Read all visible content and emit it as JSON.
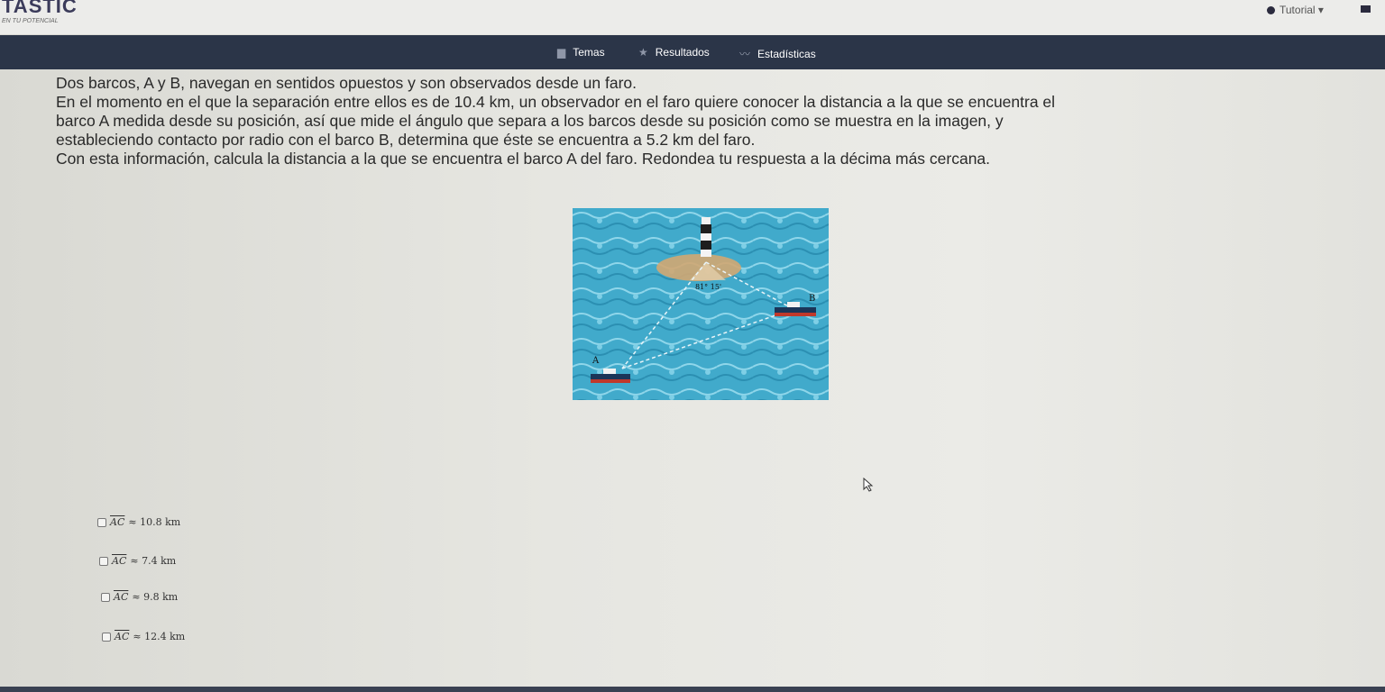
{
  "header": {
    "logo": "TASTIC",
    "slogan": "EN TU POTENCIAL",
    "tutorial_label": "Tutorial ▾"
  },
  "nav": {
    "items": [
      {
        "label": "Temas",
        "icon": "board-icon"
      },
      {
        "label": "Resultados",
        "icon": "star-icon"
      },
      {
        "label": "Estadísticas",
        "icon": "trend-icon"
      }
    ]
  },
  "problem": {
    "line1": "Dos barcos, A y B, navegan en sentidos opuestos y son observados desde un faro.",
    "line2": "En el momento en el que la separación entre ellos es de 10.4 km, un observador en el faro quiere conocer la distancia a la que se encuentra el",
    "line3": "barco A medida desde su posición, así que mide el ángulo que separa a los barcos desde su posición como se muestra en la imagen, y",
    "line4": "estableciendo contacto por radio con el barco B, determina que éste se encuentra a 5.2 km del faro.",
    "line5": "Con esta información, calcula la distancia a la que se encuentra el barco A del faro. Redondea tu respuesta a la décima más cercana."
  },
  "figure": {
    "angle_label": "81° 15'",
    "label_a": "A",
    "label_b": "B",
    "colors": {
      "water": "#3fa9c9",
      "island": "#d2a772",
      "boat_hull": "#c0392b"
    }
  },
  "options": [
    {
      "segment": "AC",
      "value": "≈ 10.8 km"
    },
    {
      "segment": "AC",
      "value": "≈ 7.4 km"
    },
    {
      "segment": "AC",
      "value": "≈ 9.8 km"
    },
    {
      "segment": "AC",
      "value": "≈ 12.4 km"
    }
  ]
}
